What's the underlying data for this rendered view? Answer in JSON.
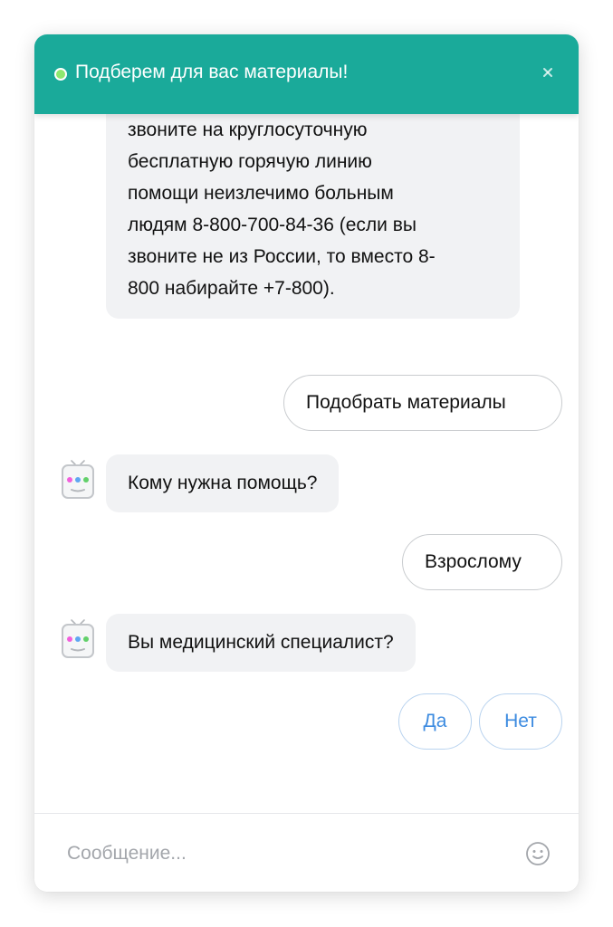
{
  "header": {
    "title": "Подберем для вас материалы!",
    "close_symbol": "×",
    "background_color": "#1aaa9a",
    "status_color": "#8ee86f"
  },
  "messages": {
    "first_bot_text": "звоните на круглосуточную\nбесплатную горячую линию\nпомощи  неизлечимо больным\nлюдям 8-800-700-84-36 (если вы\nзвоните не из России, то вместо 8-\n800 набирайте +7-800).",
    "user_reply_1": "Подобрать материалы",
    "bot_question_1": "Кому нужна помощь?",
    "user_reply_2": "Взрослому",
    "bot_question_2": "Вы медицинский специалист?"
  },
  "quick_replies": {
    "yes": "Да",
    "no": "Нет",
    "accent_color": "#3d8be0"
  },
  "composer": {
    "placeholder": "Сообщение...",
    "emoji_icon": "smiley-icon"
  },
  "icons": {
    "avatar": "robot-avatar-icon",
    "status": "online-status-icon",
    "close": "close-icon"
  }
}
